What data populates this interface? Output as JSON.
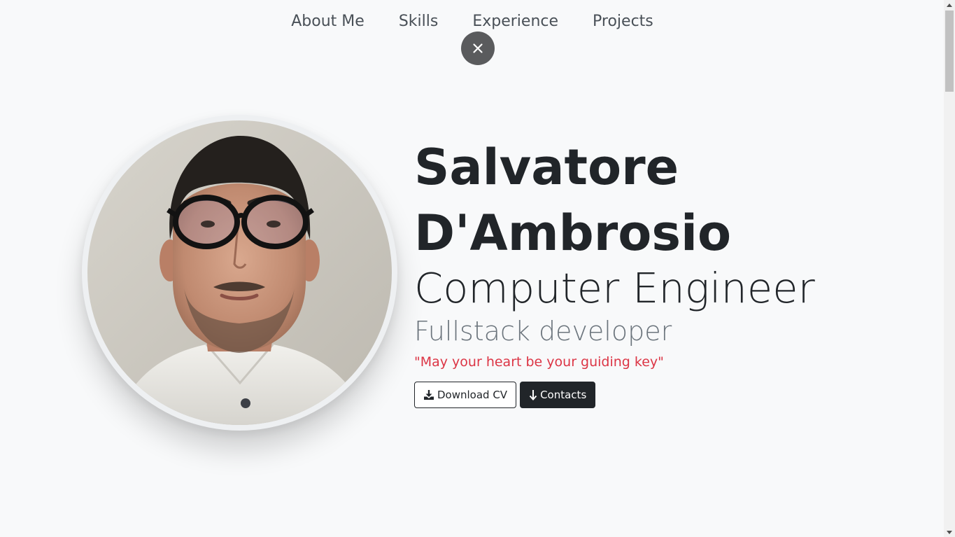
{
  "nav": {
    "items": [
      {
        "label": "About Me"
      },
      {
        "label": "Skills"
      },
      {
        "label": "Experience"
      },
      {
        "label": "Projects"
      }
    ],
    "close_icon": "close-icon"
  },
  "hero": {
    "name_line1": "Salvatore",
    "name_line2": "D'Ambrosio",
    "role": "Computer Engineer",
    "subtitle": "Fullstack developer",
    "motto": "\"May your heart be your guiding key\"",
    "buttons": {
      "download_cv": {
        "label": "Download CV",
        "icon": "download-icon"
      },
      "contacts": {
        "label": "Contacts",
        "icon": "arrow-down-icon"
      }
    }
  },
  "colors": {
    "background": "#f8f9fa",
    "text": "#212529",
    "muted": "#6c757d",
    "accent_red": "#dc3545",
    "close_button": "#5a5b5d"
  }
}
